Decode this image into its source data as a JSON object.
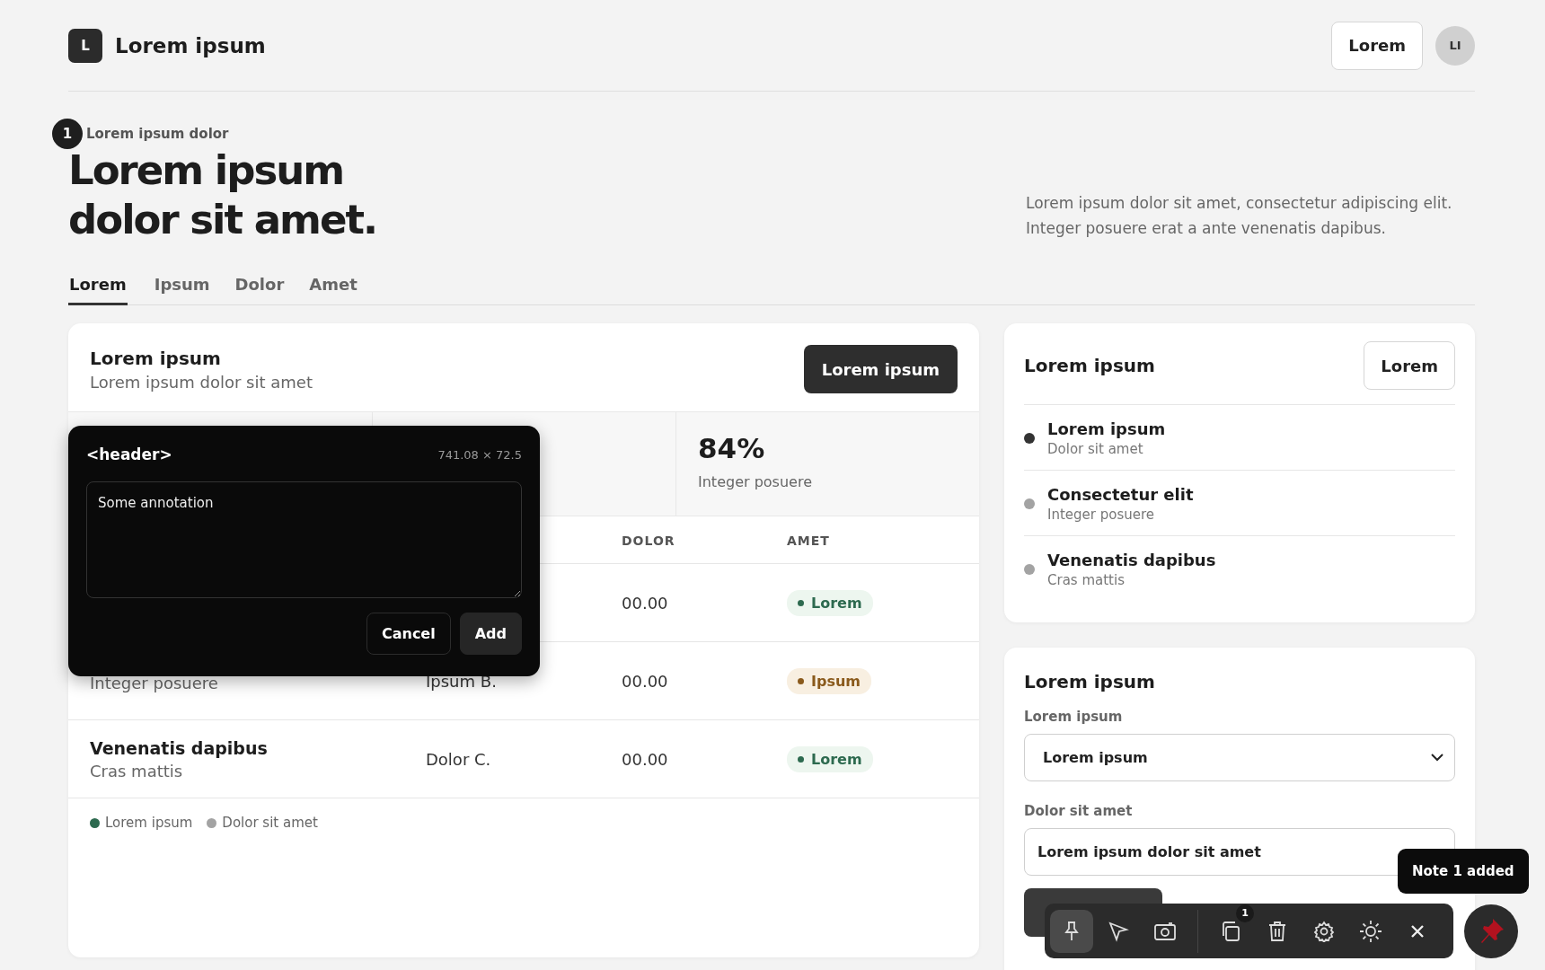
{
  "brand": {
    "logo": "L",
    "name": "Lorem ipsum"
  },
  "header_actions": {
    "button": "Lorem",
    "avatar": "LI"
  },
  "hero": {
    "marker": "1",
    "eyebrow": "Lorem ipsum dolor",
    "title_lines": [
      "Lorem ipsum",
      "dolor sit amet."
    ],
    "description": "Lorem ipsum dolor sit amet, consectetur adipiscing elit. Integer posuere erat a ante venenatis dapibus."
  },
  "tabs": [
    {
      "label": "Lorem",
      "selected": true
    },
    {
      "label": "Ipsum",
      "selected": false
    },
    {
      "label": "Dolor",
      "selected": false
    },
    {
      "label": "Amet",
      "selected": false
    }
  ],
  "main_card": {
    "title": "Lorem ipsum",
    "subtitle": "Lorem ipsum dolor sit amet",
    "button": "Lorem ipsum",
    "stats": [
      {
        "value": "84%",
        "label": "Integer posuere"
      }
    ],
    "columns": [
      "DOLOR",
      "AMET"
    ],
    "rows": [
      {
        "dolor": "00.00",
        "status": {
          "label": "Lorem",
          "kind": "positive"
        }
      },
      {
        "detail": "Integer posuere",
        "column_2": "Ipsum B.",
        "dolor": "00.00",
        "status": {
          "label": "Ipsum",
          "kind": "pending"
        }
      },
      {
        "name": "Venenatis dapibus",
        "detail": "Cras mattis",
        "column_2": "Dolor C.",
        "dolor": "00.00",
        "status": {
          "label": "Lorem",
          "kind": "positive"
        }
      }
    ],
    "legend": [
      {
        "label": "Lorem ipsum",
        "color": "#2d6a4f"
      },
      {
        "label": "Dolor sit amet",
        "color": "#a3a3a3"
      }
    ]
  },
  "annotation_popover": {
    "tag": "<header>",
    "size": "741.08 × 72.5",
    "value": "Some annotation",
    "buttons": [
      "Cancel",
      "Add"
    ]
  },
  "list_card": {
    "title": "Lorem ipsum",
    "button": "Lorem",
    "items": [
      {
        "title": "Lorem ipsum",
        "subtitle": "Dolor sit amet",
        "color": "#333333"
      },
      {
        "title": "Consectetur elit",
        "subtitle": "Integer posuere",
        "color": "#a3a3a3"
      },
      {
        "title": "Venenatis dapibus",
        "subtitle": "Cras mattis",
        "color": "#a3a3a3"
      }
    ]
  },
  "form_card": {
    "title": "Lorem ipsum",
    "fields": [
      {
        "kind": "select",
        "label": "Lorem ipsum",
        "value": "Lorem ipsum"
      },
      {
        "kind": "input",
        "label": "Dolor sit amet",
        "value": "Lorem ipsum dolor sit amet"
      }
    ]
  },
  "toolbar": {
    "groups": [
      [
        {
          "kind": "pin",
          "selected": true
        },
        {
          "kind": "cursor",
          "selected": false
        },
        {
          "kind": "camera",
          "selected": false
        }
      ],
      [
        {
          "kind": "copy",
          "selected": false,
          "badge": "1"
        },
        {
          "kind": "trash",
          "selected": false
        },
        {
          "kind": "gear",
          "selected": false
        },
        {
          "kind": "sun",
          "selected": false
        },
        {
          "kind": "close",
          "selected": false
        }
      ]
    ]
  },
  "toast": "Note 1 added"
}
